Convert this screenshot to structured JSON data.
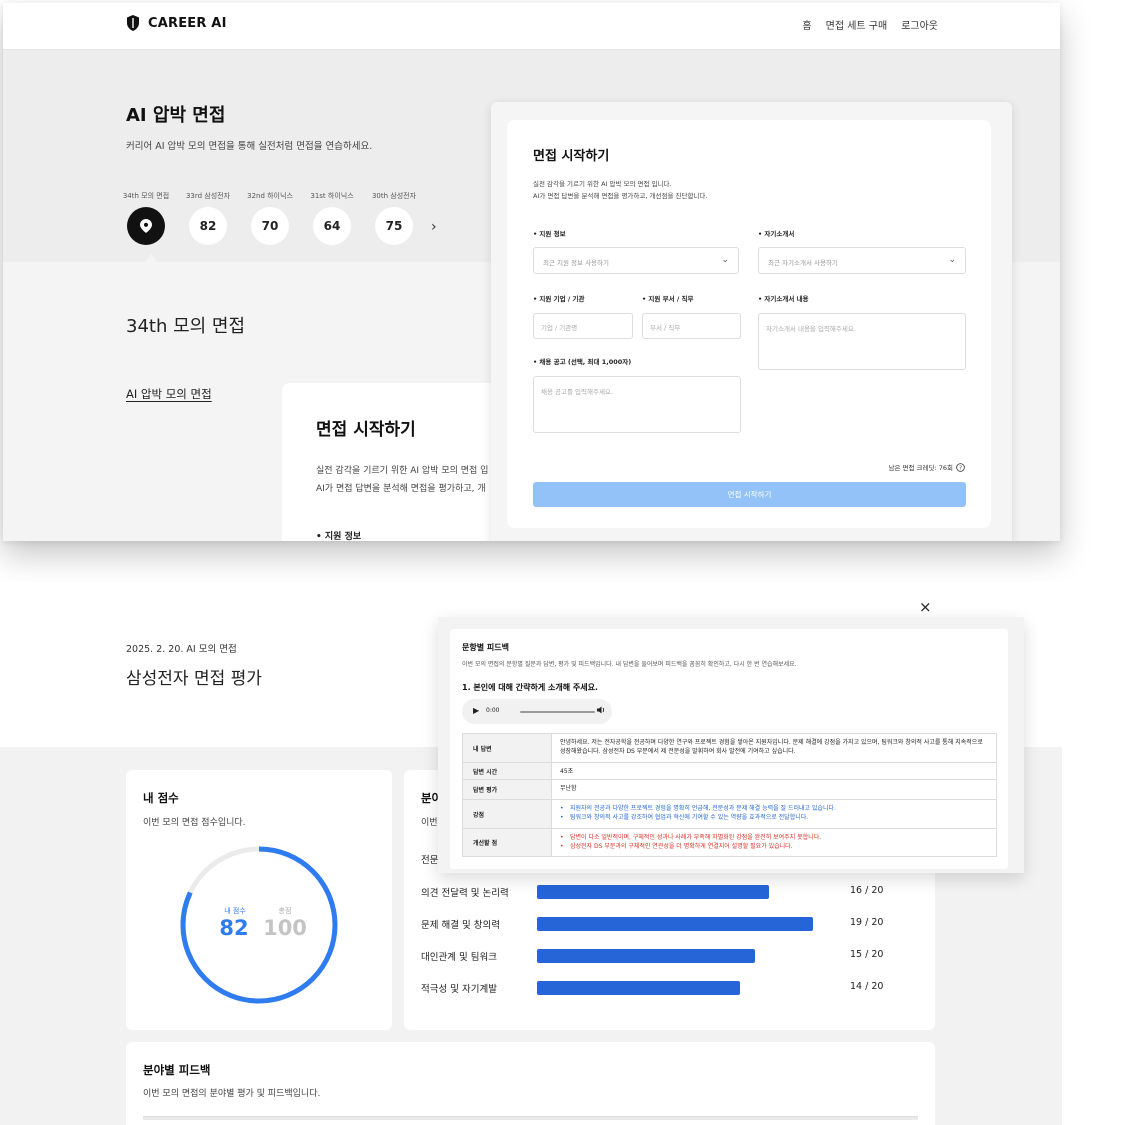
{
  "top": {
    "brand": "CAREER AI",
    "nav": [
      "홈",
      "면접 세트 구매",
      "로그아웃"
    ],
    "hero_title": "AI 압박 면접",
    "hero_subtitle": "커리어 AI 압박 모의 면접을 통해 실전처럼 면접을 연습하세요.",
    "history": [
      {
        "label": "34th 모의 면접",
        "value": "",
        "active": true
      },
      {
        "label": "33rd 삼성전자",
        "value": "82"
      },
      {
        "label": "32nd 하이닉스",
        "value": "70"
      },
      {
        "label": "31st 하이닉스",
        "value": "64"
      },
      {
        "label": "30th 삼성전자",
        "value": "75"
      }
    ],
    "session_title": "34th 모의 면접",
    "session_link": "AI 압박 모의 면접",
    "bg_card": {
      "title": "면접 시작하기",
      "line1": "실전 감각을 기르기 위한 AI 압박 모의 면접 입",
      "line2": "AI가 면접 답변을 분석해 면접을 평가하고, 개",
      "section": "• 지원 정보"
    },
    "modal": {
      "title": "면접 시작하기",
      "desc1": "실전 감각을 기르기 위한 AI 압박 모의 면접 입니다.",
      "desc2": "AI가 면접 답변을 분석해 면접을 평가하고, 개선점을 진단합니다.",
      "label_support": "• 지원 정보",
      "select_support": "최근 지원 정보 사용하기",
      "label_cover": "• 자기소개서",
      "select_cover": "최근 자기소개서 사용하기",
      "label_company": "• 지원 기업 / 기관",
      "ph_company": "기업 / 기관명",
      "label_dept": "• 지원 부서 / 직무",
      "ph_dept": "부서 / 직무",
      "label_cover_content": "• 자기소개서 내용",
      "ph_cover_content": "자기소개서 내용을 입력해주세요.",
      "label_posting": "• 채용 공고 (선택, 최대 1,000자)",
      "ph_posting": "채용 공고를 입력해주세요.",
      "credit": "남은 면접 크레딧: 76회",
      "button": "면접 시작하기"
    }
  },
  "bottom": {
    "date": "2025. 2. 20.  AI 모의 면접",
    "title": "삼성전자 면접 평가",
    "score_card": {
      "title": "내 점수",
      "subtitle": "이번 모의 면접 점수입니다.",
      "mine_label": "내 점수",
      "mine": "82",
      "total_label": "총점",
      "total": "100",
      "fraction": 0.82
    },
    "category_card": {
      "title": "분야",
      "subtitle": "이번",
      "first_row": "전문",
      "rows": [
        {
          "label": "의견 전달력 및 논리력",
          "value": "16 / 20",
          "score": 16
        },
        {
          "label": "문제 해결 및 창의력",
          "value": "19 / 20",
          "score": 19
        },
        {
          "label": "대인관계 및 팀워크",
          "value": "15 / 20",
          "score": 15
        },
        {
          "label": "적극성 및 자기계발",
          "value": "14 / 20",
          "score": 14
        }
      ],
      "max": 20
    },
    "feedback_card": {
      "title": "분야별 피드백",
      "subtitle": "이번 모의 면접의 분야별 평가 및 피드백입니다."
    }
  },
  "qf_modal": {
    "close": "×",
    "title": "문항별 피드백",
    "desc": "이번 모의 면접의 문항별 질문과 답변, 평가 및 피드백입니다. 내 답변을 들어보며 피드백을 꼼꼼히 확인하고, 다시 한 번 연습해보세요.",
    "question": "1. 본인에 대해 간략하게 소개해 주세요.",
    "audio_time": "0:00",
    "rows": {
      "answer_head": "내 답변",
      "answer": "안녕하세요. 저는 전자공학을 전공하며 다양한 연구와 프로젝트 경험을 쌓아온 지원자입니다. 문제 해결에 강점을 가지고 있으며, 팀워크와 창의적 사고를 통해 지속적으로 성장해왔습니다. 삼성전자 DS 부문에서 제 전문성을 발휘하여 회사 발전에 기여하고 싶습니다.",
      "time_head": "답변 시간",
      "time": "45초",
      "eval_head": "답변 평가",
      "eval": "무난함",
      "strength_head": "강점",
      "strengths": [
        "지원자의 전공과 다양한 프로젝트 경험을 명확히 언급해, 전문성과 문제 해결 능력을 잘 드러내고 있습니다.",
        "팀워크와 창의적 사고를 강조하여 협업과 혁신에 기여할 수 있는 역량을 효과적으로 전달합니다."
      ],
      "improve_head": "개선할 점",
      "improvements": [
        "답변이 다소 일반적이며, 구체적인 성과나 사례가 부족해 차별화된 강점을 완전히 보여주지 못합니다.",
        "삼성전자 DS 부문과의 구체적인 연관성을 더 명확하게 연결지어 설명할 필요가 있습니다."
      ]
    }
  }
}
